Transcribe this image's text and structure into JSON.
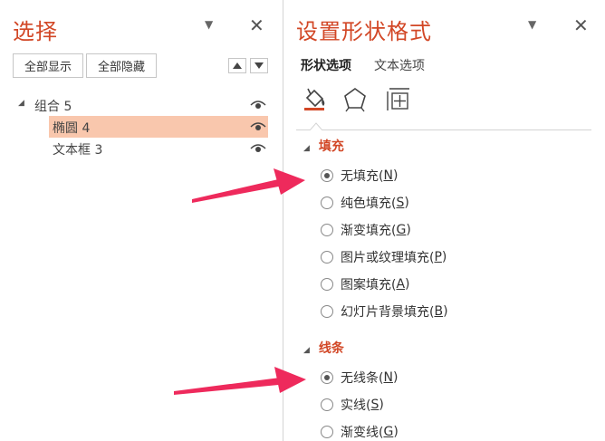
{
  "selection_pane": {
    "title": "选择",
    "show_all": "全部显示",
    "hide_all": "全部隐藏",
    "items": [
      {
        "label": "组合 5",
        "expanded": true,
        "selected": false
      },
      {
        "label": "椭圆 4",
        "selected": true
      },
      {
        "label": "文本框 3",
        "selected": false
      }
    ]
  },
  "format_pane": {
    "title": "设置形状格式",
    "tabs": [
      "形状选项",
      "文本选项"
    ],
    "icon_tabs": [
      "fill-line-icon",
      "effects-pentagon-icon",
      "size-properties-icon"
    ],
    "fill": {
      "heading": "填充",
      "options": [
        {
          "text": "无填充(",
          "key": "N",
          "tail": ")",
          "checked": true
        },
        {
          "text": "纯色填充(",
          "key": "S",
          "tail": ")",
          "checked": false
        },
        {
          "text": "渐变填充(",
          "key": "G",
          "tail": ")",
          "checked": false
        },
        {
          "text": "图片或纹理填充(",
          "key": "P",
          "tail": ")",
          "checked": false
        },
        {
          "text": "图案填充(",
          "key": "A",
          "tail": ")",
          "checked": false
        },
        {
          "text": "幻灯片背景填充(",
          "key": "B",
          "tail": ")",
          "checked": false
        }
      ]
    },
    "line": {
      "heading": "线条",
      "options": [
        {
          "text": "无线条(",
          "key": "N",
          "tail": ")",
          "checked": true
        },
        {
          "text": "实线(",
          "key": "S",
          "tail": ")",
          "checked": false
        },
        {
          "text": "渐变线(",
          "key": "G",
          "tail": ")",
          "checked": false
        }
      ]
    }
  },
  "colors": {
    "accent": "#d24726",
    "highlight": "#f9c7ad",
    "arrow": "#ee2a5c"
  }
}
